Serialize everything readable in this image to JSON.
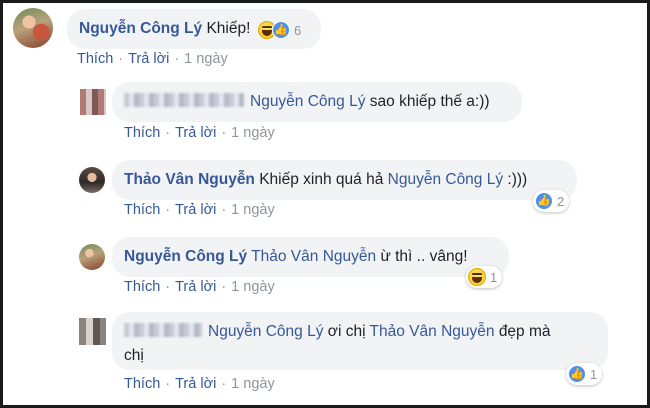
{
  "actions": {
    "like": "Thích",
    "reply": "Trả lời",
    "sep": "·",
    "time": "1 ngày"
  },
  "comments": [
    {
      "author": "Nguyễn Công Lý",
      "text": "Khiếp!",
      "reactions": {
        "types": [
          "haha-icon",
          "like-icon"
        ],
        "count": "6"
      }
    },
    {
      "author_blurred": true,
      "tag": "Nguyễn Công Lý",
      "text": "sao khiếp thế a:))"
    },
    {
      "author": "Thảo Vân Nguyễn",
      "text": "Khiếp xinh quá hả",
      "tag": "Nguyễn Công Lý",
      "text_after": ":)))",
      "reactions": {
        "types": [
          "like-icon"
        ],
        "count": "2"
      }
    },
    {
      "author": "Nguyễn Công Lý",
      "tag": "Thảo Vân Nguyễn",
      "text": "ừ thì .. vâng!",
      "reactions": {
        "types": [
          "haha-icon"
        ],
        "count": "1"
      }
    },
    {
      "author_blurred": true,
      "tag": "Nguyễn Công Lý",
      "text": "ơi chị",
      "tag2": "Thảo Vân Nguyễn",
      "text_after": "đẹp mà chị",
      "reactions": {
        "types": [
          "like-icon"
        ],
        "count": "1"
      }
    }
  ],
  "colors": {
    "link": "#365899",
    "bubble": "#f2f3f5",
    "meta": "#90949c",
    "like": "#4a8ff2",
    "haha": "#f7c21b"
  }
}
